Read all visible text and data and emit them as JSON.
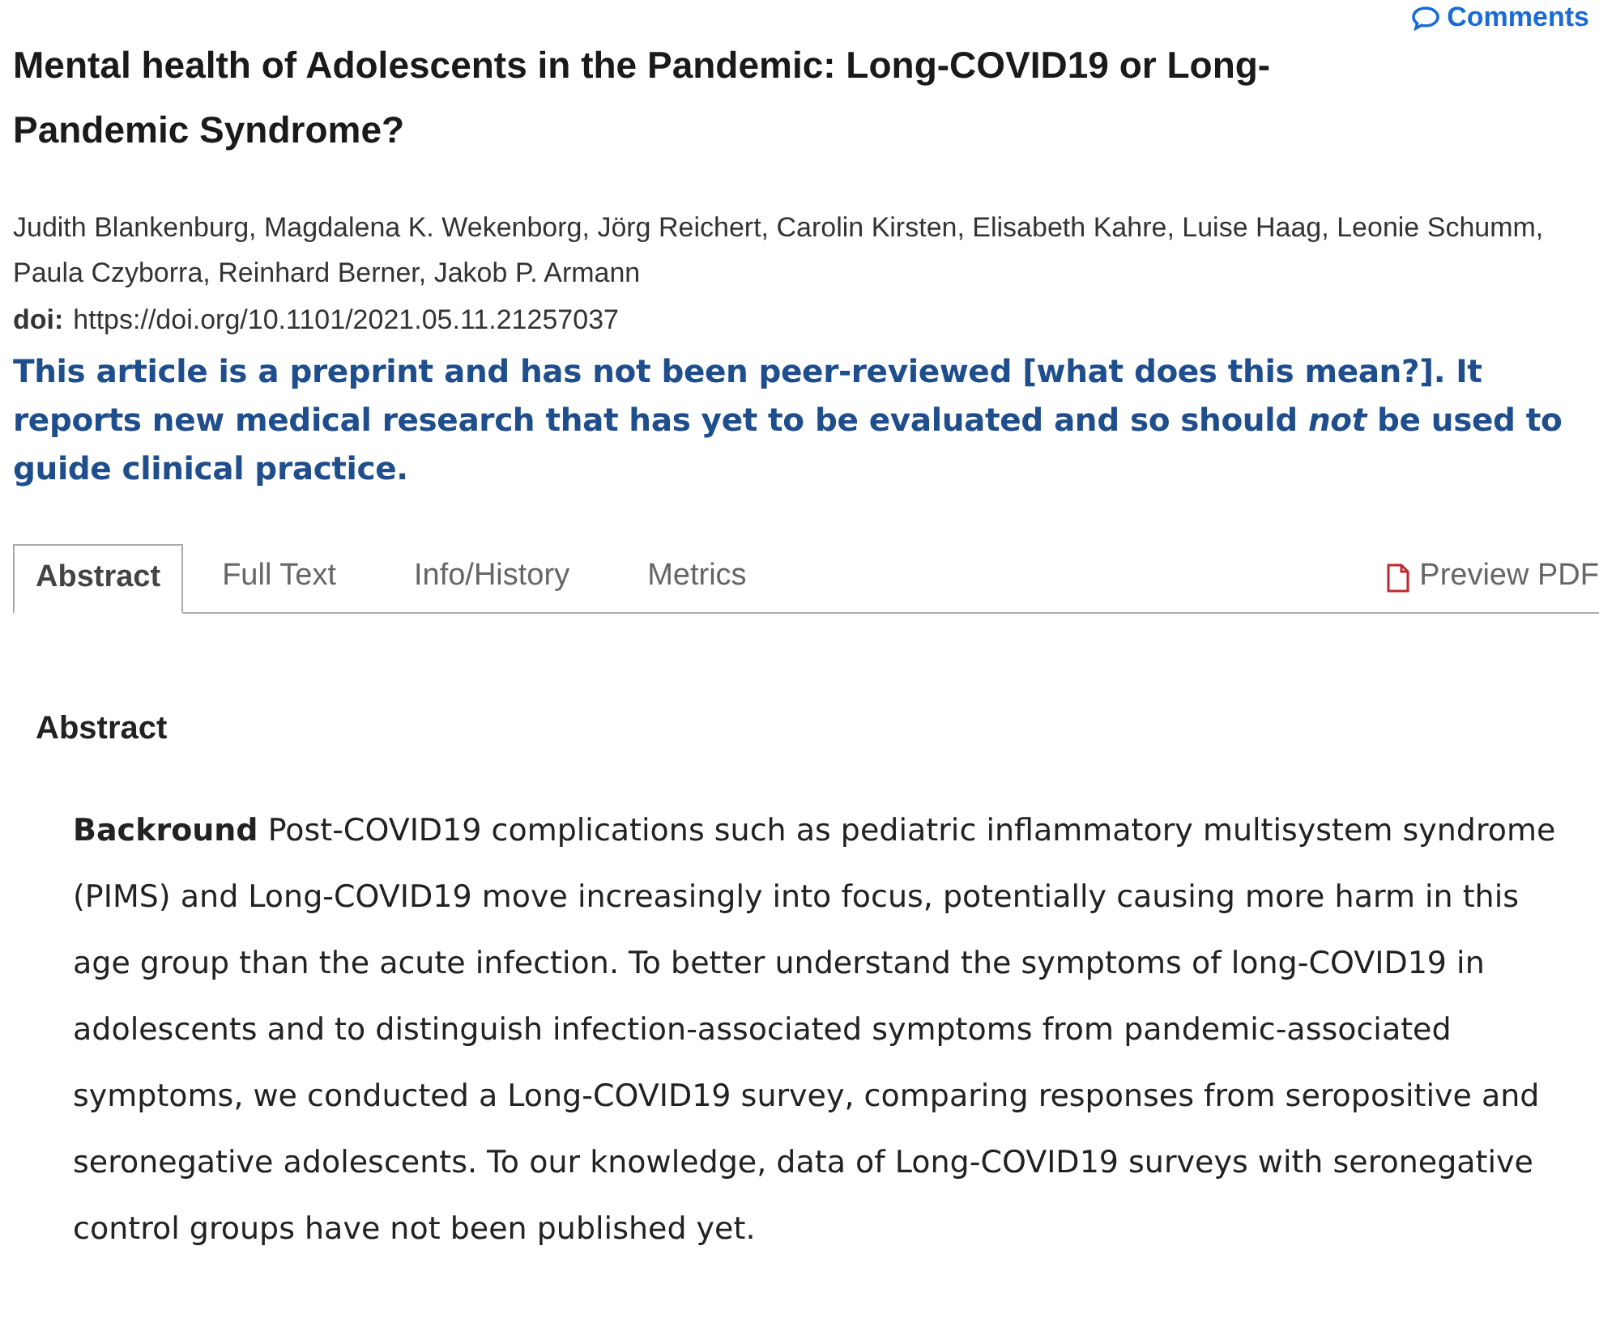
{
  "comments_link": "Comments",
  "title": "Mental health of Adolescents in the Pandemic: Long-COVID19 or Long-Pandemic Syndrome?",
  "authors": "Judith Blankenburg, Magdalena K. Wekenborg, Jörg Reichert, Carolin Kirsten, Elisabeth Kahre, Luise Haag, Leonie Schumm, Paula Czyborra, Reinhard Berner, Jakob P. Armann",
  "doi": {
    "label": "doi:",
    "value": "https://doi.org/10.1101/2021.05.11.21257037"
  },
  "notice": {
    "before": "This article is a preprint and has not been peer-reviewed",
    "link": "[what does this mean?]",
    "after": ". It reports new medical research that has yet to be evaluated and so should *not* be used to guide clinical practice."
  },
  "tabs": [
    {
      "label": "Abstract",
      "selected": true
    },
    {
      "label": "Full Text",
      "selected": false
    },
    {
      "label": "Info/History",
      "selected": false
    },
    {
      "label": "Metrics",
      "selected": false
    }
  ],
  "preview_pdf": "Preview PDF",
  "abstract": {
    "heading": "Abstract",
    "paragraph": "**Backround** Post-COVID19 complications such as pediatric inflammatory multisystem syndrome (PIMS) and Long-COVID19 move increasingly into focus, potentially causing more harm in this age group than the acute infection. To better understand the symptoms of long-COVID19 in adolescents and to distinguish infection-associated symptoms from pandemic-associated symptoms, we conducted a Long-COVID19 survey, comparing responses from seropositive and seronegative adolescents. To our knowledge, data of Long-COVID19 surveys with seronegative control groups have not been published yet."
  }
}
